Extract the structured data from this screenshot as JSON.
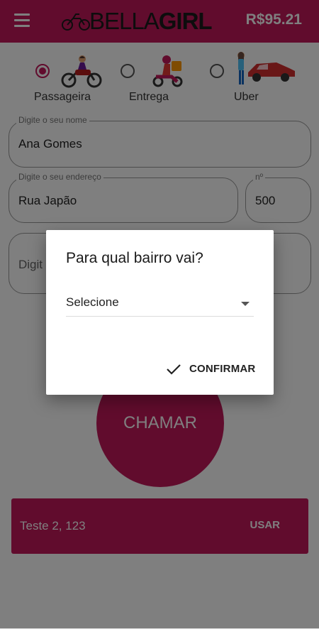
{
  "appbar": {
    "logo_bella": "BELLA",
    "logo_girl": "GIRL",
    "balance": "R$95.21",
    "brand_color": "#c2185b"
  },
  "ride_types": [
    {
      "label": "Passageira",
      "selected": true,
      "icon": "motorcycle-rider-icon"
    },
    {
      "label": "Entrega",
      "selected": false,
      "icon": "delivery-scooter-icon"
    },
    {
      "label": "Uber",
      "selected": false,
      "icon": "car-driver-icon"
    }
  ],
  "form": {
    "name_label": "Digite o seu nome",
    "name_value": "Ana Gomes",
    "address_label": "Digite o seu endereço",
    "address_value": "Rua Japão",
    "number_label": "nº",
    "number_value": "500",
    "third_placeholder": "Digit"
  },
  "call_button": "CHAMAR",
  "saved_address": {
    "text": "Teste 2, 123",
    "use_label": "USAR"
  },
  "dialog": {
    "title": "Para qual bairro vai?",
    "select_value": "Selecione",
    "confirm_label": "CONFIRMAR"
  }
}
